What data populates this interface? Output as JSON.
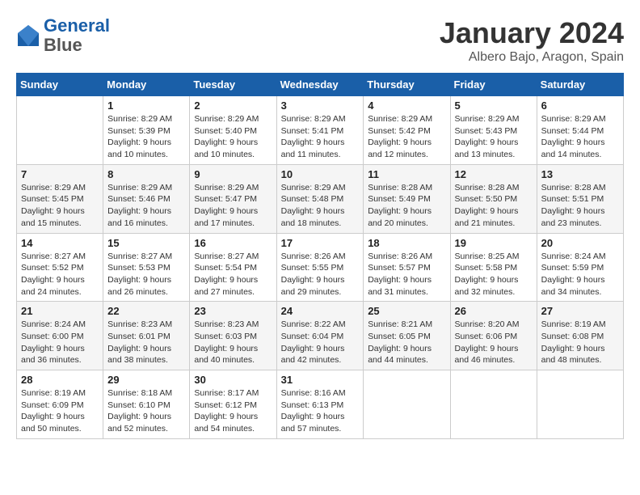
{
  "header": {
    "logo_line1": "General",
    "logo_line2": "Blue",
    "month_title": "January 2024",
    "location": "Albero Bajo, Aragon, Spain"
  },
  "days_of_week": [
    "Sunday",
    "Monday",
    "Tuesday",
    "Wednesday",
    "Thursday",
    "Friday",
    "Saturday"
  ],
  "weeks": [
    [
      {
        "day": "",
        "info": ""
      },
      {
        "day": "1",
        "info": "Sunrise: 8:29 AM\nSunset: 5:39 PM\nDaylight: 9 hours\nand 10 minutes."
      },
      {
        "day": "2",
        "info": "Sunrise: 8:29 AM\nSunset: 5:40 PM\nDaylight: 9 hours\nand 10 minutes."
      },
      {
        "day": "3",
        "info": "Sunrise: 8:29 AM\nSunset: 5:41 PM\nDaylight: 9 hours\nand 11 minutes."
      },
      {
        "day": "4",
        "info": "Sunrise: 8:29 AM\nSunset: 5:42 PM\nDaylight: 9 hours\nand 12 minutes."
      },
      {
        "day": "5",
        "info": "Sunrise: 8:29 AM\nSunset: 5:43 PM\nDaylight: 9 hours\nand 13 minutes."
      },
      {
        "day": "6",
        "info": "Sunrise: 8:29 AM\nSunset: 5:44 PM\nDaylight: 9 hours\nand 14 minutes."
      }
    ],
    [
      {
        "day": "7",
        "info": "Sunrise: 8:29 AM\nSunset: 5:45 PM\nDaylight: 9 hours\nand 15 minutes."
      },
      {
        "day": "8",
        "info": "Sunrise: 8:29 AM\nSunset: 5:46 PM\nDaylight: 9 hours\nand 16 minutes."
      },
      {
        "day": "9",
        "info": "Sunrise: 8:29 AM\nSunset: 5:47 PM\nDaylight: 9 hours\nand 17 minutes."
      },
      {
        "day": "10",
        "info": "Sunrise: 8:29 AM\nSunset: 5:48 PM\nDaylight: 9 hours\nand 18 minutes."
      },
      {
        "day": "11",
        "info": "Sunrise: 8:28 AM\nSunset: 5:49 PM\nDaylight: 9 hours\nand 20 minutes."
      },
      {
        "day": "12",
        "info": "Sunrise: 8:28 AM\nSunset: 5:50 PM\nDaylight: 9 hours\nand 21 minutes."
      },
      {
        "day": "13",
        "info": "Sunrise: 8:28 AM\nSunset: 5:51 PM\nDaylight: 9 hours\nand 23 minutes."
      }
    ],
    [
      {
        "day": "14",
        "info": "Sunrise: 8:27 AM\nSunset: 5:52 PM\nDaylight: 9 hours\nand 24 minutes."
      },
      {
        "day": "15",
        "info": "Sunrise: 8:27 AM\nSunset: 5:53 PM\nDaylight: 9 hours\nand 26 minutes."
      },
      {
        "day": "16",
        "info": "Sunrise: 8:27 AM\nSunset: 5:54 PM\nDaylight: 9 hours\nand 27 minutes."
      },
      {
        "day": "17",
        "info": "Sunrise: 8:26 AM\nSunset: 5:55 PM\nDaylight: 9 hours\nand 29 minutes."
      },
      {
        "day": "18",
        "info": "Sunrise: 8:26 AM\nSunset: 5:57 PM\nDaylight: 9 hours\nand 31 minutes."
      },
      {
        "day": "19",
        "info": "Sunrise: 8:25 AM\nSunset: 5:58 PM\nDaylight: 9 hours\nand 32 minutes."
      },
      {
        "day": "20",
        "info": "Sunrise: 8:24 AM\nSunset: 5:59 PM\nDaylight: 9 hours\nand 34 minutes."
      }
    ],
    [
      {
        "day": "21",
        "info": "Sunrise: 8:24 AM\nSunset: 6:00 PM\nDaylight: 9 hours\nand 36 minutes."
      },
      {
        "day": "22",
        "info": "Sunrise: 8:23 AM\nSunset: 6:01 PM\nDaylight: 9 hours\nand 38 minutes."
      },
      {
        "day": "23",
        "info": "Sunrise: 8:23 AM\nSunset: 6:03 PM\nDaylight: 9 hours\nand 40 minutes."
      },
      {
        "day": "24",
        "info": "Sunrise: 8:22 AM\nSunset: 6:04 PM\nDaylight: 9 hours\nand 42 minutes."
      },
      {
        "day": "25",
        "info": "Sunrise: 8:21 AM\nSunset: 6:05 PM\nDaylight: 9 hours\nand 44 minutes."
      },
      {
        "day": "26",
        "info": "Sunrise: 8:20 AM\nSunset: 6:06 PM\nDaylight: 9 hours\nand 46 minutes."
      },
      {
        "day": "27",
        "info": "Sunrise: 8:19 AM\nSunset: 6:08 PM\nDaylight: 9 hours\nand 48 minutes."
      }
    ],
    [
      {
        "day": "28",
        "info": "Sunrise: 8:19 AM\nSunset: 6:09 PM\nDaylight: 9 hours\nand 50 minutes."
      },
      {
        "day": "29",
        "info": "Sunrise: 8:18 AM\nSunset: 6:10 PM\nDaylight: 9 hours\nand 52 minutes."
      },
      {
        "day": "30",
        "info": "Sunrise: 8:17 AM\nSunset: 6:12 PM\nDaylight: 9 hours\nand 54 minutes."
      },
      {
        "day": "31",
        "info": "Sunrise: 8:16 AM\nSunset: 6:13 PM\nDaylight: 9 hours\nand 57 minutes."
      },
      {
        "day": "",
        "info": ""
      },
      {
        "day": "",
        "info": ""
      },
      {
        "day": "",
        "info": ""
      }
    ]
  ]
}
